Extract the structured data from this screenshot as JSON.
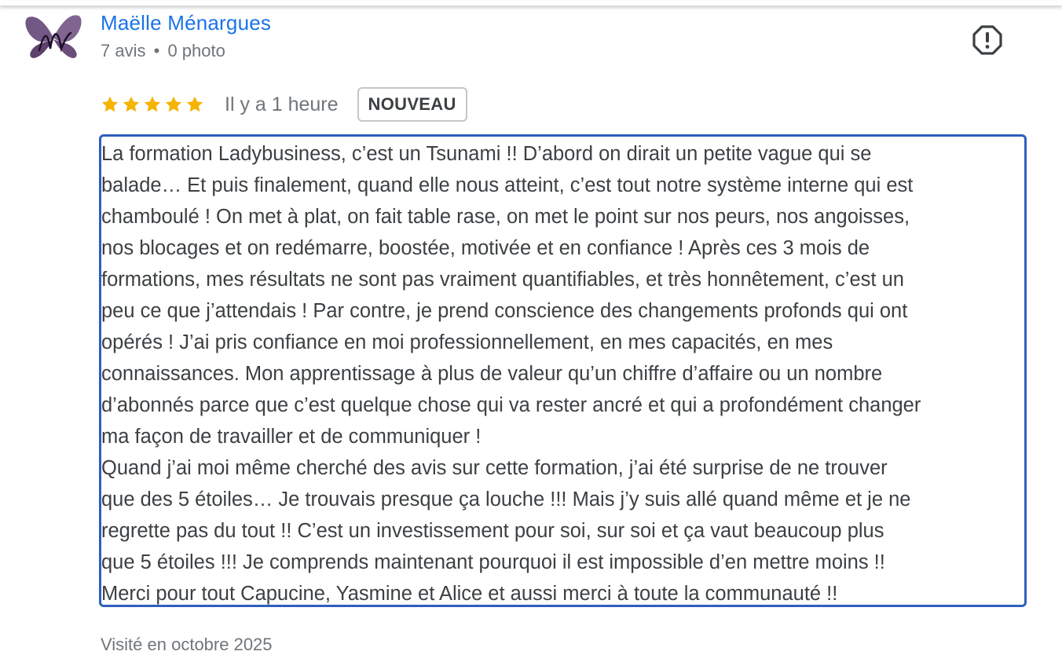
{
  "review": {
    "author": {
      "name": "Maëlle Ménargues",
      "reviews_count": "7 avis",
      "separator": "•",
      "photos_count": "0 photo",
      "avatar_icon": "butterfly-avatar-icon"
    },
    "rating": 5,
    "rating_max": 5,
    "time_ago": "Il y a 1 heure",
    "badge": "NOUVEAU",
    "text": "La formation Ladybusiness, c’est un Tsunami !! D’abord on dirait un petite vague qui se\nbalade… Et puis finalement, quand elle nous atteint, c’est tout notre système interne qui est\nchamboulé ! On met à plat, on fait table rase, on met le point sur nos peurs, nos angoisses,\nnos blocages et on redémarre, boostée, motivée et en confiance ! Après ces 3 mois de\nformations, mes résultats ne sont pas vraiment quantifiables, et très honnêtement, c’est un\npeu ce que j’attendais ! Par contre, je prend conscience des changements profonds qui ont\nopérés ! J’ai pris confiance en moi professionnellement, en mes capacités, en mes\nconnaissances. Mon apprentissage à plus de valeur qu’un chiffre d’affaire ou un nombre\nd’abonnés parce que c’est quelque chose qui va rester ancré et qui a profondément changer\nma façon de travailler et de communiquer !\nQuand j’ai moi même cherché des avis sur cette formation, j’ai été surprise de ne trouver\nque des 5 étoiles… Je trouvais presque ça louche !!! Mais j’y suis allé quand même et je ne\nregrette pas du tout !! C’est un investissement pour soi, sur soi et ça vaut beaucoup plus\nque 5 étoiles !!! Je comprends maintenant pourquoi il est impossible d’en mettre moins !!\nMerci pour tout Capucine, Yasmine et Alice et aussi merci à toute la communauté !!",
    "visited": "Visité en octobre 2025"
  },
  "icons": {
    "report": "report-flag-icon",
    "star": "star-icon"
  },
  "colors": {
    "author_link": "#1a73e8",
    "star": "#f4b400",
    "selection_border": "#2e5fbf",
    "muted_text": "#70757a"
  }
}
